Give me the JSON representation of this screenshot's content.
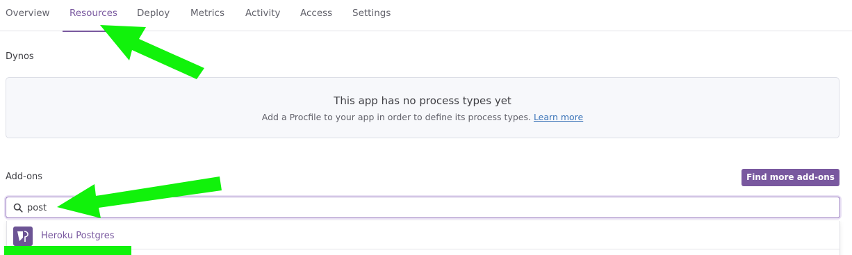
{
  "tabs": [
    {
      "label": "Overview"
    },
    {
      "label": "Resources"
    },
    {
      "label": "Deploy"
    },
    {
      "label": "Metrics"
    },
    {
      "label": "Activity"
    },
    {
      "label": "Access"
    },
    {
      "label": "Settings"
    }
  ],
  "active_tab": "Resources",
  "dynos": {
    "title": "Dynos",
    "empty_title": "This app has no process types yet",
    "empty_text": "Add a Procfile to your app in order to define its process types.",
    "learn_more": "Learn more"
  },
  "addons": {
    "title": "Add-ons",
    "find_more_label": "Find more add-ons",
    "search_value": "post",
    "results": [
      {
        "name": "Heroku Postgres",
        "icon": "heroku-postgres-icon"
      }
    ]
  },
  "colors": {
    "accent": "#79589f",
    "annotation": "#11f20b",
    "link": "#3b74b8"
  },
  "icons": [
    "search-icon",
    "heroku-postgres-icon"
  ]
}
